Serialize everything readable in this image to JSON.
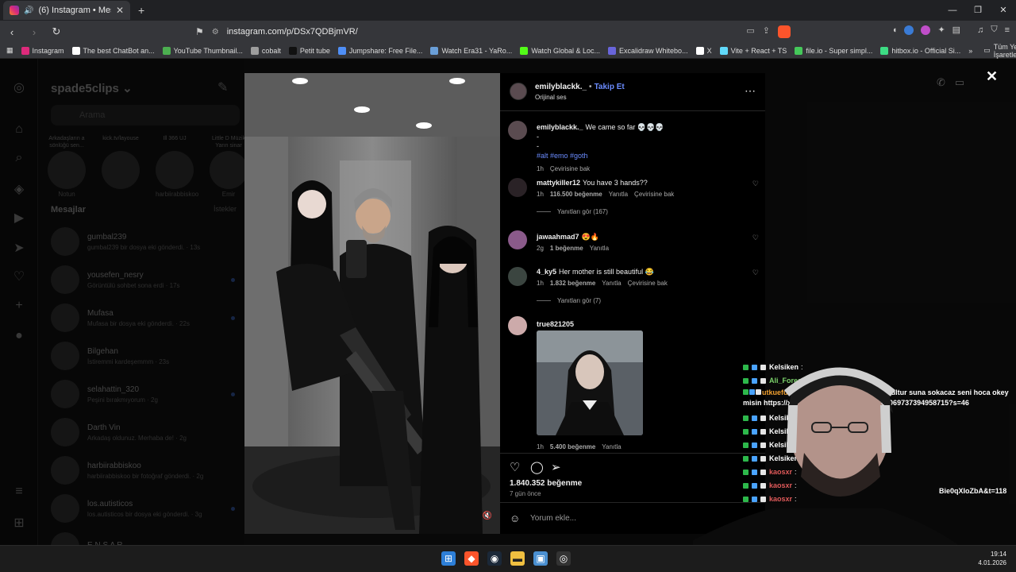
{
  "browser": {
    "tab_title": "(6) Instagram • Mesajlar",
    "url": "instagram.com/p/DSx7QDBjmVR/",
    "bookmarks": [
      {
        "label": "Instagram",
        "color": "#dd2a7b"
      },
      {
        "label": "The best ChatBot an...",
        "color": "#ffffff"
      },
      {
        "label": "YouTube Thumbnail...",
        "color": "#4caf50"
      },
      {
        "label": "cobalt",
        "color": "#9e9e9e"
      },
      {
        "label": "Petit tube",
        "color": "#111111"
      },
      {
        "label": "Jumpshare: Free File...",
        "color": "#4f8ff7"
      },
      {
        "label": "Watch Era31 - YaRo...",
        "color": "#6a9fd8"
      },
      {
        "label": "Watch Global & Loc...",
        "color": "#53fc18"
      },
      {
        "label": "Excalidraw Whitebo...",
        "color": "#6965db"
      },
      {
        "label": "X",
        "color": "#ffffff"
      },
      {
        "label": "Vite + React + TS",
        "color": "#61dafb"
      },
      {
        "label": "file.io - Super simpl...",
        "color": "#45c85a"
      },
      {
        "label": "hitbox.io - Official Si...",
        "color": "#3ddc84"
      }
    ],
    "all_bookmarks": "Tüm Yer İşaretleri"
  },
  "dm_panel": {
    "username": "spade5clips",
    "search_placeholder": "Arama",
    "notes": [
      {
        "bubble": "Arkadaşların a sönlüğü sen...",
        "label": "Notun"
      },
      {
        "bubble": "kick.tv/layouse",
        "label": ""
      },
      {
        "bubble": "Ill 366 UJ",
        "label": "harbiirabbiskoo"
      },
      {
        "bubble": "Little D Müzik Yarın sinar",
        "label": "Emir"
      }
    ],
    "section_title": "Mesajlar",
    "requests_label": "İstekler",
    "threads": [
      {
        "name": "gumbal239",
        "preview": "gumbal239 bir dosya eki gönderdi. · 13s",
        "unread": false
      },
      {
        "name": "yousefen_nesry",
        "preview": "Görüntülü sohbet sona erdi · 17s",
        "unread": true
      },
      {
        "name": "Mufasa",
        "preview": "Mufasa bir dosya eki gönderdi. · 22s",
        "unread": true
      },
      {
        "name": "Bilgehan",
        "preview": "İstiremmi kardeşemmm · 23s",
        "unread": false
      },
      {
        "name": "selahattin_320",
        "preview": "Peşini bırakmıyorum · 2g",
        "unread": true
      },
      {
        "name": "Darth Vin",
        "preview": "Arkadaş oldunuz. Merhaba de! · 2g",
        "unread": false
      },
      {
        "name": "harbiirabbiskoo",
        "preview": "harbiirabbiskoo bir fotoğraf gönderdi. · 2g",
        "unread": false
      },
      {
        "name": "los.autisticos",
        "preview": "los.autisticos bir dosya eki gönderdi. · 3g",
        "unread": true
      },
      {
        "name": "E N S A R",
        "preview": "",
        "unread": false
      }
    ]
  },
  "post": {
    "author": "emilyblackk._",
    "follow": "Takip Et",
    "audio": "Orijinal ses",
    "caption_user": "emilyblackk._",
    "caption_text": "We came so far 💀💀💀",
    "caption_dash": "-",
    "caption_tags": "#alt #emo #goth",
    "caption_time": "1h",
    "caption_translate": "Çevirisine bak",
    "comments": [
      {
        "user": "mattykiller12",
        "text": "You have 3 hands??",
        "time": "1h",
        "likes": "116.500 beğenme",
        "reply": "Yanıtla",
        "translate": "Çevirisine bak",
        "replies": "Yanıtları gör (167)"
      },
      {
        "user": "jawaahmad7",
        "text": "😍🔥",
        "time": "2g",
        "likes": "1 beğenme",
        "reply": "Yanıtla"
      },
      {
        "user": "4_ky5",
        "text": "Her mother is still beautiful 😂",
        "time": "1h",
        "likes": "1.832 beğenme",
        "reply": "Yanıtla",
        "translate": "Çevirisine bak",
        "replies": "Yanıtları gör (7)"
      },
      {
        "user": "true821205",
        "text": "",
        "time": "1h",
        "likes": "5.400 beğenme",
        "reply": "Yanıtla"
      }
    ],
    "total_likes": "1.840.352 beğenme",
    "posted_ago": "7 gün önce",
    "add_comment_placeholder": "Yorum ekle..."
  },
  "chat_overlay": {
    "lines": [
      {
        "user": "Kelsiken",
        "color": "#ffffff",
        "msg": ""
      },
      {
        "user": "Ali_Forester_TR",
        "color": "#7cd36b",
        "msg": ""
      },
      {
        "user": "utkuefdf41",
        "color": "#f0a030",
        "msg": "seni kurt yapip yasini kucultur suna sokacaz seni hoca okey misin https://x.com/big5turkiye/status/2006069737394958715?s=46"
      },
      {
        "user": "Kelsiken",
        "color": "#ffffff",
        "msg": ""
      },
      {
        "user": "Kelsiken",
        "color": "#ffffff",
        "msg": ""
      },
      {
        "user": "Kelsiken",
        "color": "#ffffff",
        "msg": ""
      },
      {
        "user": "Kelsiken",
        "color": "#ffffff",
        "msg": ""
      },
      {
        "user": "kaosxr",
        "color": "#e05a5a",
        "msg": ""
      },
      {
        "user": "kaosxr",
        "color": "#e05a5a",
        "msg": ""
      },
      {
        "user": "kaosxr",
        "color": "#e05a5a",
        "msg": ""
      }
    ],
    "truncated_url": "Bie0qXIoZbA&t=118"
  },
  "taskbar": {
    "time": "19:14",
    "date": "4.01.2026"
  }
}
